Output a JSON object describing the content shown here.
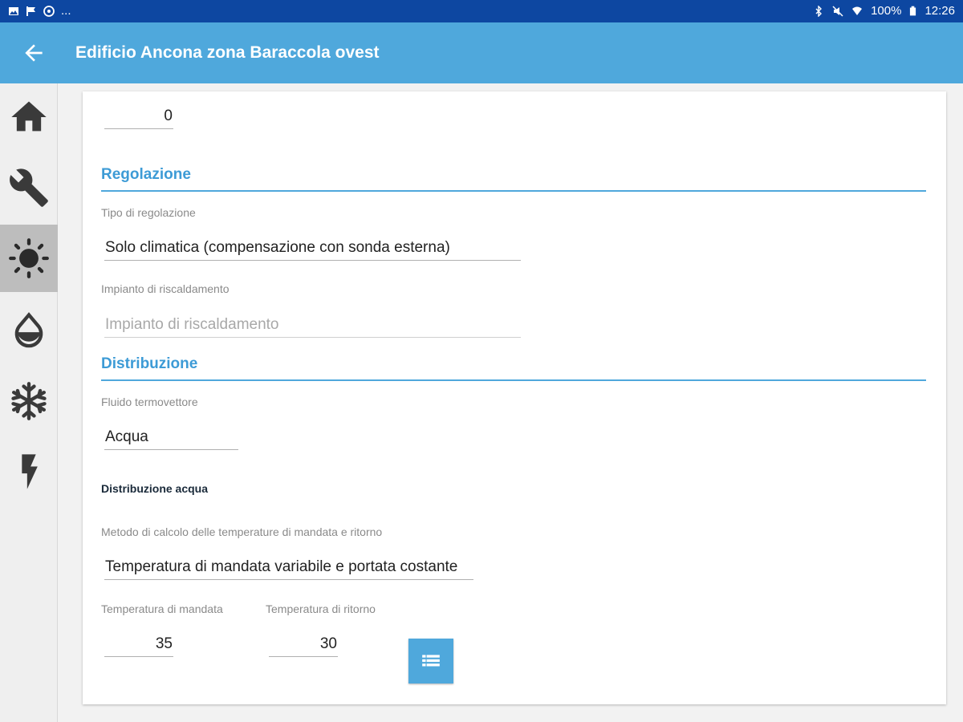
{
  "status_bar": {
    "left_text": "...",
    "battery": "100%",
    "time": "12:26",
    "left_icons": [
      "image-icon",
      "flag-icon",
      "disc-icon"
    ],
    "right_icons": [
      "bluetooth-icon",
      "mute-icon",
      "wifi-icon",
      "battery-icon"
    ]
  },
  "app_bar": {
    "title": "Edificio Ancona zona Baraccola ovest",
    "color": "#4fa8dc"
  },
  "sidebar": {
    "items": [
      {
        "icon": "home-icon",
        "active": false
      },
      {
        "icon": "wrench-icon",
        "active": false
      },
      {
        "icon": "sun-icon",
        "active": true
      },
      {
        "icon": "water-drop-icon",
        "active": false
      },
      {
        "icon": "snowflake-icon",
        "active": false
      },
      {
        "icon": "lightning-icon",
        "active": false
      }
    ]
  },
  "form": {
    "top_value": "0",
    "regolazione": {
      "section_title": "Regolazione",
      "tipo_label": "Tipo di regolazione",
      "tipo_value": "Solo climatica (compensazione con sonda esterna)",
      "impianto_label": "Impianto di riscaldamento",
      "impianto_placeholder": "Impianto di riscaldamento"
    },
    "distribuzione": {
      "section_title": "Distribuzione",
      "fluido_label": "Fluido termovettore",
      "fluido_value": "Acqua",
      "subheading": "Distribuzione acqua",
      "metodo_label": "Metodo di calcolo delle temperature di mandata e ritorno",
      "metodo_value": "Temperatura di mandata variabile e portata costante",
      "mandata_label": "Temperatura di mandata",
      "mandata_value": "35",
      "ritorno_label": "Temperatura di ritorno",
      "ritorno_value": "30",
      "table_button_icon": "table-icon"
    }
  }
}
